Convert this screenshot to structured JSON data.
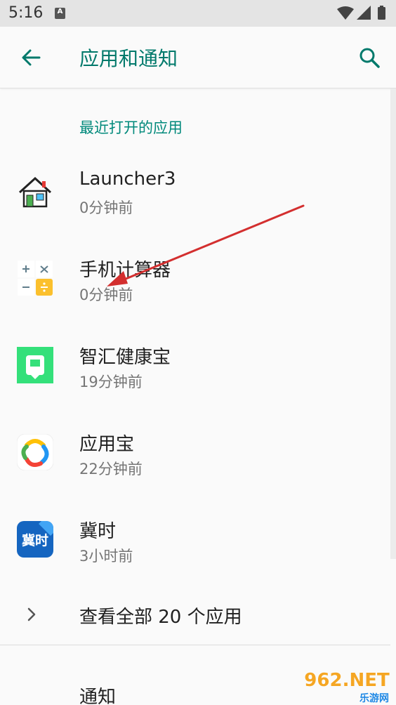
{
  "status_bar": {
    "time": "5:16",
    "notification_glyph": "A"
  },
  "app_bar": {
    "title": "应用和通知",
    "back_icon": "arrow-left-icon",
    "search_icon": "search-icon"
  },
  "section": {
    "title": "最近打开的应用"
  },
  "apps": [
    {
      "name": "Launcher3",
      "time": "0分钟前",
      "icon": "launcher-house-icon"
    },
    {
      "name": "手机计算器",
      "time": "0分钟前",
      "icon": "calculator-icon"
    },
    {
      "name": "智汇健康宝",
      "time": "19分钟前",
      "icon": "health-green-icon"
    },
    {
      "name": "应用宝",
      "time": "22分钟前",
      "icon": "app-store-icon"
    },
    {
      "name": "冀时",
      "time": "3小时前",
      "icon": "jishi-icon",
      "icon_text": "冀时"
    }
  ],
  "see_all": {
    "label": "查看全部 20 个应用"
  },
  "notify": {
    "label": "通知"
  },
  "watermark": {
    "text": "962.NET",
    "subtext": "乐游网"
  },
  "colors": {
    "accent": "#00796b",
    "annotation_arrow": "#d32f2f"
  }
}
